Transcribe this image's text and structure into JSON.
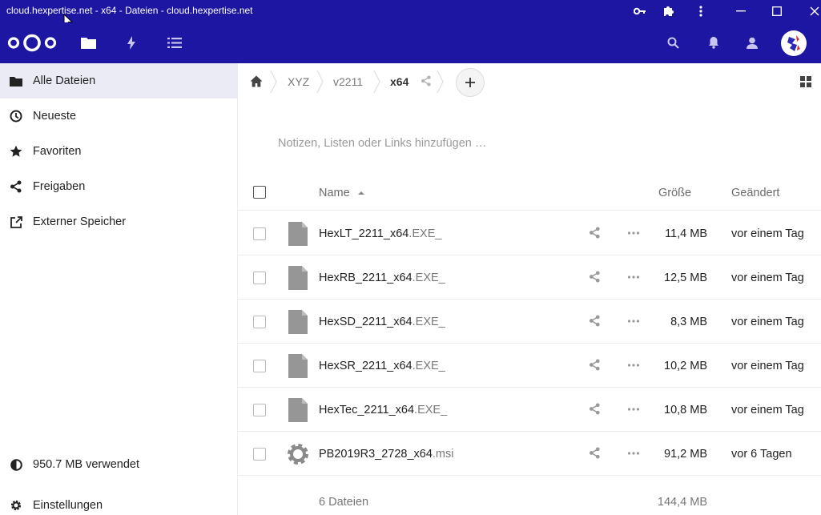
{
  "window": {
    "title": "cloud.hexpertise.net - x64 - Dateien - cloud.hexpertise.net"
  },
  "colors": {
    "brand": "#1c16a3",
    "active_nav": "#ebebf6"
  },
  "header": {
    "apps": [
      {
        "name": "files",
        "icon": "folder-icon"
      },
      {
        "name": "activity",
        "icon": "lightning-icon"
      },
      {
        "name": "tasks",
        "icon": "list-icon"
      }
    ],
    "right_icons": [
      "search-icon",
      "bell-icon",
      "contacts-icon",
      "avatar"
    ]
  },
  "sidebar": {
    "items": [
      {
        "label": "Alle Dateien",
        "icon": "folder-icon",
        "active": true
      },
      {
        "label": "Neueste",
        "icon": "clock-icon"
      },
      {
        "label": "Favoriten",
        "icon": "star-icon"
      },
      {
        "label": "Freigaben",
        "icon": "share-icon"
      },
      {
        "label": "Externer Speicher",
        "icon": "external-link-icon"
      }
    ],
    "quota": "950.7 MB verwendet",
    "settings": "Einstellungen"
  },
  "breadcrumb": {
    "items": [
      "XYZ",
      "v2211",
      "x64"
    ]
  },
  "notes_placeholder": "Notizen, Listen oder Links hinzufügen …",
  "table": {
    "headers": {
      "name": "Name",
      "size": "Größe",
      "modified": "Geändert"
    },
    "rows": [
      {
        "base": "HexLT_2211_x64",
        "ext": ".EXE_",
        "size": "11,4 MB",
        "modified": "vor einem Tag",
        "icon": "file-icon"
      },
      {
        "base": "HexRB_2211_x64",
        "ext": ".EXE_",
        "size": "12,5 MB",
        "modified": "vor einem Tag",
        "icon": "file-icon"
      },
      {
        "base": "HexSD_2211_x64",
        "ext": ".EXE_",
        "size": "8,3 MB",
        "modified": "vor einem Tag",
        "icon": "file-icon"
      },
      {
        "base": "HexSR_2211_x64",
        "ext": ".EXE_",
        "size": "10,2 MB",
        "modified": "vor einem Tag",
        "icon": "file-icon"
      },
      {
        "base": "HexTec_2211_x64",
        "ext": ".EXE_",
        "size": "10,8 MB",
        "modified": "vor einem Tag",
        "icon": "file-icon"
      },
      {
        "base": "PB2019R3_2728_x64",
        "ext": ".msi",
        "size": "91,2 MB",
        "modified": "vor 6 Tagen",
        "icon": "gear-icon"
      }
    ],
    "footer": {
      "count": "6 Dateien",
      "total": "144,4 MB"
    }
  }
}
